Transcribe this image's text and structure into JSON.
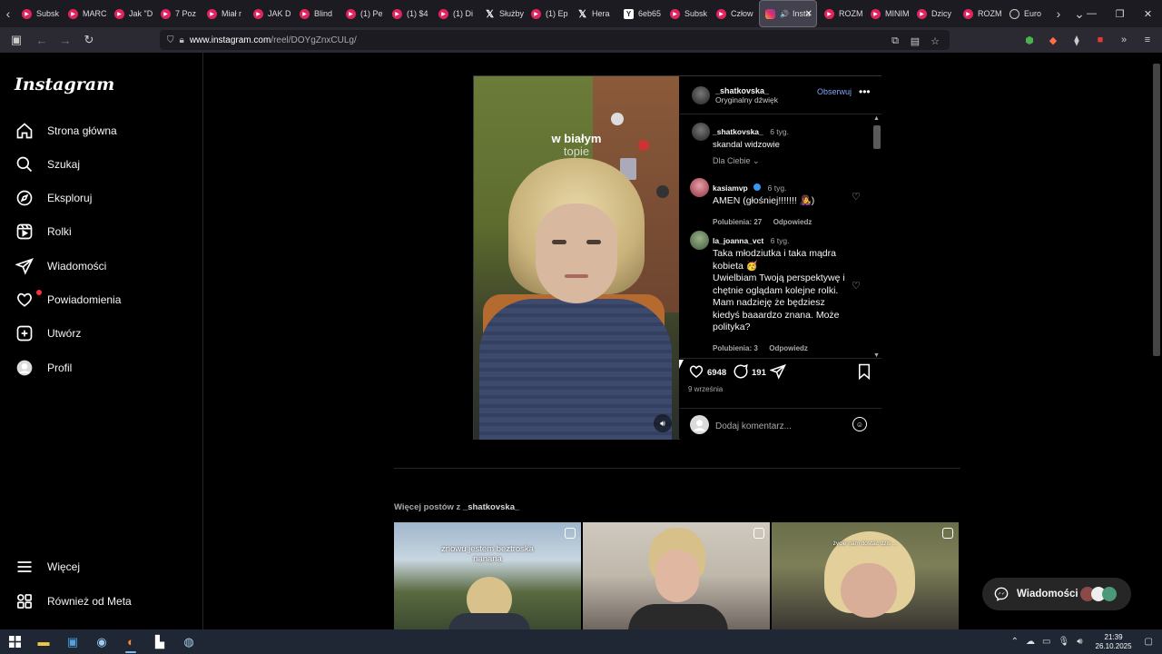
{
  "browser": {
    "tabs": [
      {
        "label": "Subsk",
        "icon": "youtube-icon"
      },
      {
        "label": "MARC",
        "icon": "youtube-icon"
      },
      {
        "label": "Jak \"D",
        "icon": "youtube-icon"
      },
      {
        "label": "7 Poz",
        "icon": "youtube-icon"
      },
      {
        "label": "Miał r",
        "icon": "youtube-icon"
      },
      {
        "label": "JAK D",
        "icon": "youtube-icon"
      },
      {
        "label": "Blind",
        "icon": "youtube-icon"
      },
      {
        "label": "(1) Pe",
        "icon": "youtube-icon"
      },
      {
        "label": "(1) $4",
        "icon": "youtube-icon"
      },
      {
        "label": "(1) Di",
        "icon": "youtube-icon"
      },
      {
        "label": "Służby",
        "icon": "x-icon"
      },
      {
        "label": "(1) Ep",
        "icon": "youtube-icon"
      },
      {
        "label": "Hera",
        "icon": "x-icon"
      },
      {
        "label": "6eb65",
        "icon": "y-combinator-icon"
      },
      {
        "label": "Subsk",
        "icon": "youtube-icon"
      },
      {
        "label": "Człow",
        "icon": "youtube-icon"
      }
    ],
    "active_tab": {
      "label": "Insta",
      "icon": "instagram-icon"
    },
    "tabs_after": [
      {
        "label": "ROZM",
        "icon": "youtube-icon"
      },
      {
        "label": "MINIM",
        "icon": "youtube-icon"
      },
      {
        "label": "Dzicy",
        "icon": "youtube-icon"
      },
      {
        "label": "ROZM",
        "icon": "youtube-icon"
      },
      {
        "label": "Euro",
        "icon": "globe-icon"
      }
    ],
    "url_host": "www.instagram.com",
    "url_path": "/reel/DOYgZnxCULg/"
  },
  "sidebar": {
    "logo": "Instagram",
    "items": [
      {
        "label": "Strona główna",
        "icon": "home-icon"
      },
      {
        "label": "Szukaj",
        "icon": "search-icon"
      },
      {
        "label": "Eksploruj",
        "icon": "compass-icon"
      },
      {
        "label": "Rolki",
        "icon": "reels-icon"
      },
      {
        "label": "Wiadomości",
        "icon": "send-icon"
      },
      {
        "label": "Powiadomienia",
        "icon": "heart-icon"
      },
      {
        "label": "Utwórz",
        "icon": "plus-square-icon"
      },
      {
        "label": "Profil",
        "icon": "avatar-icon"
      }
    ],
    "bottom": [
      {
        "label": "Więcej",
        "icon": "menu-icon"
      },
      {
        "label": "Również od Meta",
        "icon": "meta-grid-icon"
      }
    ]
  },
  "reel": {
    "video_caption_line1": "w białym",
    "video_caption_line2": "topie",
    "author": "_shatkovska_",
    "audio": "Oryginalny dźwięk",
    "follow_label": "Obserwuj",
    "caption": {
      "user": "_shatkovska_",
      "time": "6 tyg.",
      "text": "skandal widzowie"
    },
    "sort_label": "Dla Ciebie",
    "comments": [
      {
        "user": "kasiamvp",
        "verified": true,
        "time": "6 tyg.",
        "lines": [
          "AMEN (głośniej!!!!!!! 👩‍🎤)"
        ],
        "likes_label": "Polubienia: 27",
        "reply_label": "Odpowiedz"
      },
      {
        "user": "la_joanna_vct",
        "verified": false,
        "time": "6 tyg.",
        "lines": [
          "Taka młodziutka i taka mądra",
          "kobieta 🥳",
          "Uwielbiam Twoją perspektywę i",
          "chętnie oglądam kolejne rolki.",
          "Mam nadzieję że będziesz",
          "kiedyś baaardzo znana. Może",
          "polityka?"
        ],
        "likes_label": "Polubienia: 3",
        "reply_label": "Odpowiedz"
      }
    ],
    "likes_count": "6948",
    "comments_count": "191",
    "date": "9 września",
    "comment_placeholder": "Dodaj komentarz..."
  },
  "more_posts": {
    "prefix": "Więcej postów z ",
    "user": "_shatkovska_",
    "thumbnails": [
      {
        "caption": "znowu jestem beztroska\nnanana",
        "small": false
      },
      {
        "caption": "",
        "small": false
      },
      {
        "caption": "życie nam dostać dziś ...",
        "small": true
      }
    ]
  },
  "messages_pill": {
    "label": "Wiadomości"
  },
  "taskbar": {
    "time": "21:39",
    "date": "26.10.2025"
  },
  "colors": {
    "accent": "#85a1ff",
    "notification_dot": "#ff3040",
    "background": "#000000",
    "border": "#262626"
  }
}
